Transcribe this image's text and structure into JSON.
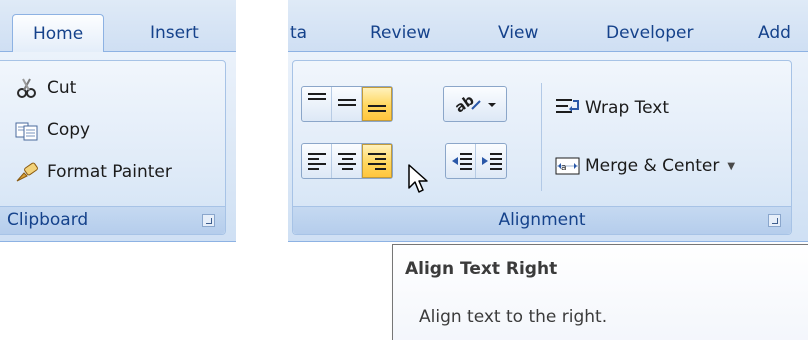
{
  "left_panel": {
    "tabs": [
      {
        "label": "Home",
        "active": true
      },
      {
        "label": "Insert",
        "active": false
      }
    ],
    "clipboard": {
      "items": [
        {
          "label": "Cut",
          "icon": "scissors-icon"
        },
        {
          "label": "Copy",
          "icon": "copy-icon"
        },
        {
          "label": "Format Painter",
          "icon": "paintbrush-icon"
        }
      ],
      "caption": "Clipboard"
    }
  },
  "right_panel": {
    "tabs": [
      {
        "label": "ta"
      },
      {
        "label": "Review"
      },
      {
        "label": "View"
      },
      {
        "label": "Developer"
      },
      {
        "label": "Add"
      }
    ],
    "alignment": {
      "caption": "Alignment",
      "wrap_text": "Wrap Text",
      "merge_center": "Merge & Center",
      "vertical_align": [
        {
          "icon": "align-top-icon",
          "active": false
        },
        {
          "icon": "align-middle-icon",
          "active": false
        },
        {
          "icon": "align-bottom-icon",
          "active": true
        }
      ],
      "horizontal_align": [
        {
          "icon": "align-text-left-icon",
          "active": false
        },
        {
          "icon": "center-text-icon",
          "active": false
        },
        {
          "icon": "align-text-right-icon",
          "active": true
        }
      ],
      "indent": [
        {
          "icon": "decrease-indent-icon"
        },
        {
          "icon": "increase-indent-icon"
        }
      ],
      "orientation_icon": "text-orientation-icon"
    }
  },
  "tooltip": {
    "title": "Align Text Right",
    "description": "Align text to the right."
  },
  "colors": {
    "ribbon": "#dce8f6",
    "group_border": "#a7c3e6",
    "active_button": "#ffd75e",
    "text": "#15428b"
  }
}
